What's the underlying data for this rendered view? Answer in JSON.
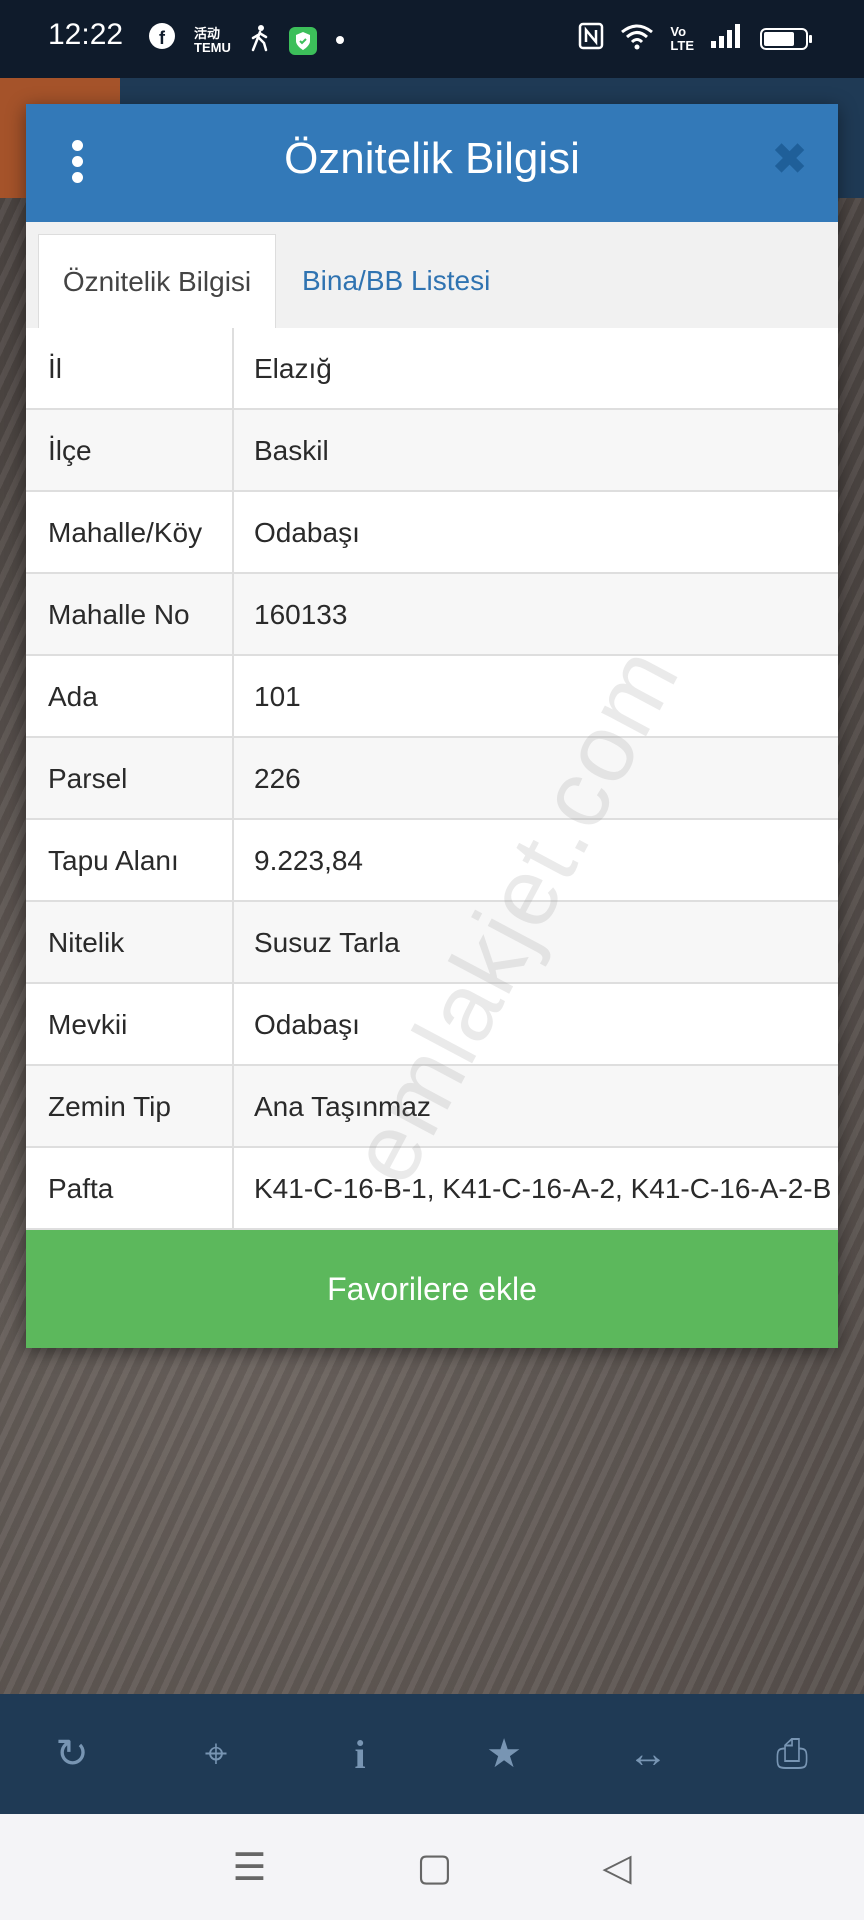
{
  "status_bar": {
    "time": "12:22",
    "left_icons": [
      "facebook-icon",
      "temu-icon",
      "walking-icon",
      "shield-icon",
      "dot-icon"
    ],
    "right_icons": [
      "nfc-icon",
      "wifi-icon",
      "volte-icon",
      "signal-icon",
      "battery-icon"
    ],
    "temu_text_top": "活动",
    "temu_text_bottom": "TEMU",
    "volte_text_top": "Vo",
    "volte_text_bottom": "LTE"
  },
  "dialog": {
    "title": "Öznitelik Bilgisi",
    "close_glyph": "✖",
    "tabs": [
      {
        "label": "Öznitelik Bilgisi",
        "active": true
      },
      {
        "label": "Bina/BB Listesi",
        "active": false
      }
    ],
    "rows": [
      {
        "label": "İl",
        "value": "Elazığ"
      },
      {
        "label": "İlçe",
        "value": "Baskil"
      },
      {
        "label": "Mahalle/Köy",
        "value": "Odabaşı"
      },
      {
        "label": "Mahalle No",
        "value": "160133"
      },
      {
        "label": "Ada",
        "value": "101"
      },
      {
        "label": "Parsel",
        "value": "226"
      },
      {
        "label": "Tapu Alanı",
        "value": "9.223,84"
      },
      {
        "label": "Nitelik",
        "value": "Susuz Tarla"
      },
      {
        "label": "Mevkii",
        "value": "Odabaşı"
      },
      {
        "label": "Zemin Tip",
        "value": "Ana Taşınmaz"
      },
      {
        "label": "Pafta",
        "value": "K41-C-16-B-1, K41-C-16-A-2, K41-C-16-A-2-B"
      }
    ],
    "favorite_button": "Favorilere ekle"
  },
  "watermark": "emlakjet.com",
  "toolbar": {
    "items": [
      {
        "name": "refresh-icon",
        "glyph": "↻"
      },
      {
        "name": "locate-icon",
        "glyph": "⌖"
      },
      {
        "name": "info-icon",
        "glyph": "i"
      },
      {
        "name": "star-icon",
        "glyph": "★"
      },
      {
        "name": "measure-icon",
        "glyph": "↔"
      },
      {
        "name": "print-icon",
        "glyph": "⎙"
      }
    ]
  },
  "nav_bar": {
    "items": [
      {
        "name": "menu-nav-icon",
        "glyph": "☰"
      },
      {
        "name": "home-nav-icon",
        "glyph": "▢"
      },
      {
        "name": "back-nav-icon",
        "glyph": "◁"
      }
    ]
  },
  "colors": {
    "header_blue": "#3379b8",
    "tab_link_blue": "#2f73b1",
    "favorite_green": "#5cb85c",
    "toolbar_navy": "#1f3a55"
  }
}
